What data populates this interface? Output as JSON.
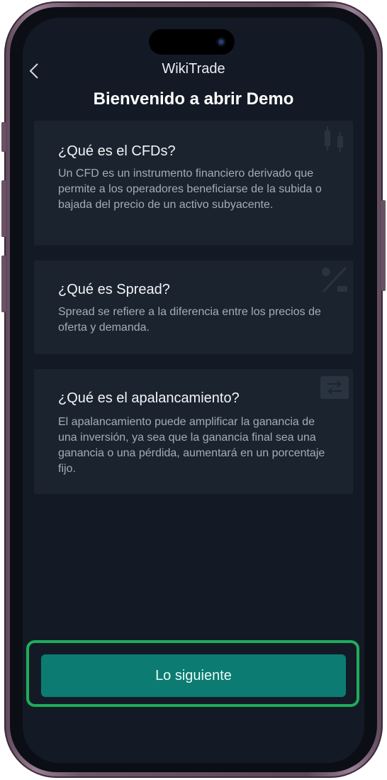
{
  "header": {
    "app_title": "WikiTrade",
    "page_title": "Bienvenido a abrir Demo"
  },
  "cards": [
    {
      "title": "¿Qué es el CFDs?",
      "description": "Un CFD es un instrumento financiero derivado que permite a los operadores beneficiarse de la subida o bajada del precio de un activo subyacente.",
      "icon": "candlestick-icon"
    },
    {
      "title": "¿Qué es Spread?",
      "description": "Spread se refiere a la diferencia entre los precios de oferta y demanda.",
      "icon": "percent-icon"
    },
    {
      "title": "¿Qué es el apalancamiento?",
      "description": "El apalancamiento puede amplificar la ganancia de una inversión, ya sea que la ganancia final sea una ganancia o una pérdida, aumentará en un porcentaje fijo.",
      "icon": "exchange-icon"
    }
  ],
  "footer": {
    "next_label": "Lo siguiente"
  },
  "colors": {
    "screen_bg": "#131a26",
    "card_bg": "#1b232f",
    "button_bg": "#0c7b72",
    "highlight_outline": "#1fac5b"
  }
}
